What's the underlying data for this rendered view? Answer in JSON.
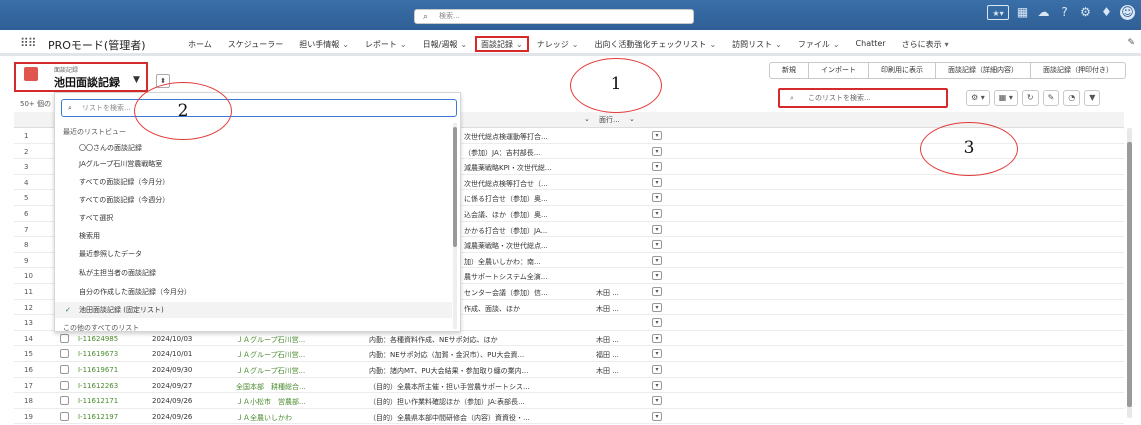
{
  "topbar": {
    "search_placeholder": "検索..."
  },
  "nav": {
    "app_name": "PROモード(管理者)",
    "items": [
      {
        "label": "ホーム",
        "chev": ""
      },
      {
        "label": "スケジューラー",
        "chev": ""
      },
      {
        "label": "担い手情報",
        "chev": "⌄"
      },
      {
        "label": "レポート",
        "chev": "⌄"
      },
      {
        "label": "日報/週報",
        "chev": "⌄"
      },
      {
        "label": "面談記録",
        "chev": "⌄"
      },
      {
        "label": "ナレッジ",
        "chev": "⌄"
      },
      {
        "label": "出向く活動強化チェックリスト",
        "chev": "⌄"
      },
      {
        "label": "訪問リスト",
        "chev": "⌄"
      },
      {
        "label": "ファイル",
        "chev": "⌄"
      },
      {
        "label": "Chatter",
        "chev": ""
      },
      {
        "label": "さらに表示",
        "chev": "▾"
      }
    ]
  },
  "header": {
    "object_small": "面談記録",
    "list_name": "池田面談記録",
    "count_text": "50+ 個の",
    "buttons": [
      "新規",
      "インポート",
      "印刷用に表示",
      "面談記録（詳細内容）",
      "面談記録（押印付き）"
    ],
    "list_search_placeholder": "このリストを検索..."
  },
  "table": {
    "header_col1": "",
    "header_col_right": "面行...",
    "rows_partial": [
      {
        "num": "1",
        "content": "次世代総点検運動等打合...",
        "owner": ""
      },
      {
        "num": "2",
        "content": "（参加）JA：吉村部長...",
        "owner": ""
      },
      {
        "num": "3",
        "content": "減農薬戦略KPI・次世代総...",
        "owner": ""
      },
      {
        "num": "4",
        "content": "次世代総点検等打合せ（...",
        "owner": ""
      },
      {
        "num": "5",
        "content": "に係る打合せ（参加）奥...",
        "owner": ""
      },
      {
        "num": "6",
        "content": "込会議、ほか（参加）奥...",
        "owner": ""
      },
      {
        "num": "7",
        "content": "かかる打合せ（参加）JA...",
        "owner": ""
      },
      {
        "num": "8",
        "content": "減農薬戦略・次世代総点...",
        "owner": ""
      },
      {
        "num": "9",
        "content": "加）全農いしかわ：南...",
        "owner": ""
      },
      {
        "num": "10",
        "content": "農サポートシステム全演...",
        "owner": ""
      },
      {
        "num": "11",
        "content": "センター会議（参加）信...",
        "owner": "木田 ..."
      },
      {
        "num": "12",
        "content": "作成、面談、ほか",
        "owner": "木田 ..."
      },
      {
        "num": "13",
        "content": "",
        "owner": ""
      }
    ],
    "rows_full": [
      {
        "num": "14",
        "id": "I-11624985",
        "date": "2024/10/03",
        "org": "ＪＡグループ石川営...",
        "content": "内勤：各種資料作成、NEサポ対応、ほか",
        "owner": "木田 ..."
      },
      {
        "num": "15",
        "id": "I-11619673",
        "date": "2024/10/01",
        "org": "ＪＡグループ石川営...",
        "content": "内勤：NEサポ対応（加賀・金沢市）、PU大会資...",
        "owner": "福田 ..."
      },
      {
        "num": "16",
        "id": "I-11619671",
        "date": "2024/09/30",
        "org": "ＪＡグループ石川営...",
        "content": "内勤：諸内MT、PU大会結果・参加取り纏の業内...",
        "owner": "木田 ..."
      },
      {
        "num": "17",
        "id": "I-11612263",
        "date": "2024/09/27",
        "org": "全国本部　耕種総合...",
        "content": "（目的）全農本所主催・担い手営農サポートシス...",
        "owner": ""
      },
      {
        "num": "18",
        "id": "I-11612171",
        "date": "2024/09/26",
        "org": "ＪＡ小松市　営農部...",
        "content": "（目的）担い作業料確認ほか（参加）JA:表部長...",
        "owner": ""
      },
      {
        "num": "19",
        "id": "I-11612197",
        "date": "2024/09/26",
        "org": "ＪＡ全農いしかわ",
        "content": "（目的）全農県本部中間研修会（内容）資資役・...",
        "owner": ""
      }
    ]
  },
  "dropdown": {
    "search_placeholder": "リストを検索...",
    "section_recent": "最近のリストビュー",
    "items": [
      "〇〇さんの面談記録",
      "JAグループ石川営農戦略室",
      "すべての面談記録（今月分）",
      "すべての面談記録（今週分）",
      "すべて選択",
      "検索用",
      "最近参照したデータ",
      "私が主担当者の面談記録",
      "自分の作成した面談記録（今月分）"
    ],
    "selected_item": "池田面談記録 (固定リスト)",
    "section_all": "この他のすべてのリスト"
  },
  "annotations": [
    "1",
    "2",
    "3"
  ]
}
